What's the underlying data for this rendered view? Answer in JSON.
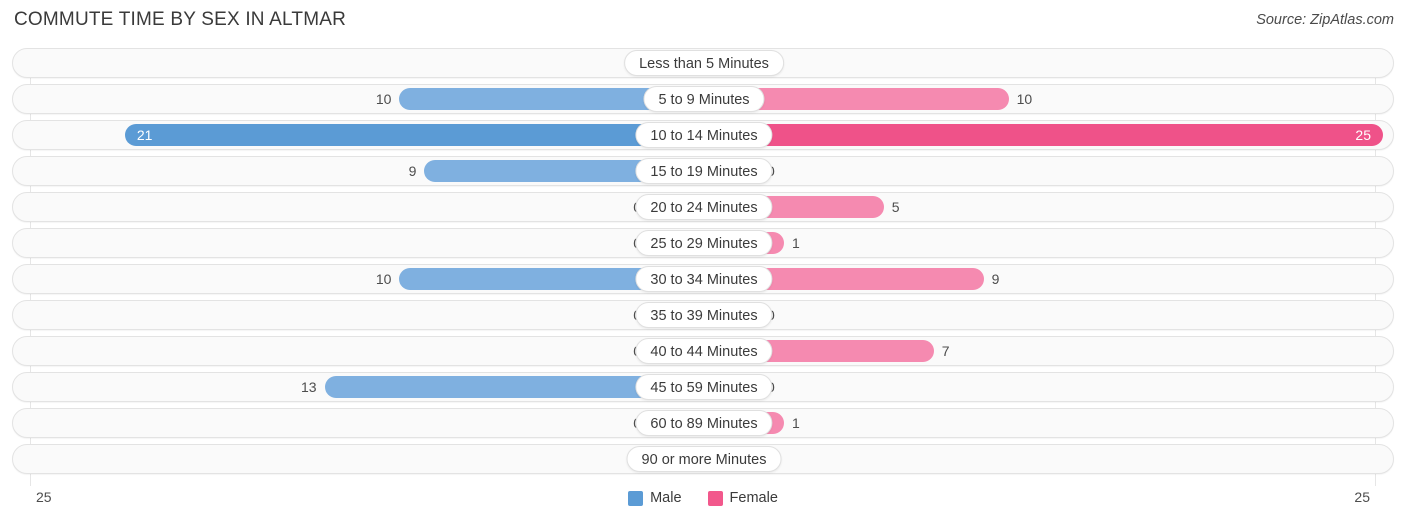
{
  "header": {
    "title": "COMMUTE TIME BY SEX IN ALTMAR",
    "source": "Source: ZipAtlas.com"
  },
  "axis": {
    "min_label": "25",
    "max_label": "25"
  },
  "legend": [
    {
      "label": "Male",
      "color": "#5b9bd5"
    },
    {
      "label": "Female",
      "color": "#f2588c"
    }
  ],
  "colors": {
    "male_normal": "#7fb0e0",
    "male_max": "#5b9bd5",
    "male_zero": "#aecbeb",
    "female_normal": "#f58ab0",
    "female_max": "#ef5289",
    "female_zero": "#f7a7c3",
    "track_bg": "#fafafa",
    "track_border": "#e3e3e3",
    "gridline": "#e6e6e6"
  },
  "chart_data": {
    "type": "bar",
    "orientation": "horizontal-diverging",
    "title": "COMMUTE TIME BY SEX IN ALTMAR",
    "xlabel": "",
    "ylabel": "",
    "xlim": [
      25,
      25
    ],
    "axis_max": 25,
    "grid": true,
    "legend_position": "bottom-center",
    "categories": [
      "Less than 5 Minutes",
      "5 to 9 Minutes",
      "10 to 14 Minutes",
      "15 to 19 Minutes",
      "20 to 24 Minutes",
      "25 to 29 Minutes",
      "30 to 34 Minutes",
      "35 to 39 Minutes",
      "40 to 44 Minutes",
      "45 to 59 Minutes",
      "60 to 89 Minutes",
      "90 or more Minutes"
    ],
    "series": [
      {
        "name": "Male",
        "values": [
          0,
          10,
          21,
          9,
          0,
          0,
          10,
          0,
          0,
          13,
          0,
          0
        ]
      },
      {
        "name": "Female",
        "values": [
          0,
          10,
          25,
          0,
          5,
          1,
          9,
          0,
          7,
          0,
          1,
          0
        ]
      }
    ]
  },
  "rows": [
    {
      "category": "Less than 5 Minutes",
      "male": "0",
      "female": "0",
      "male_value": 0,
      "female_value": 0
    },
    {
      "category": "5 to 9 Minutes",
      "male": "10",
      "female": "10",
      "male_value": 10,
      "female_value": 10
    },
    {
      "category": "10 to 14 Minutes",
      "male": "21",
      "female": "25",
      "male_value": 21,
      "female_value": 25
    },
    {
      "category": "15 to 19 Minutes",
      "male": "9",
      "female": "0",
      "male_value": 9,
      "female_value": 0
    },
    {
      "category": "20 to 24 Minutes",
      "male": "0",
      "female": "5",
      "male_value": 0,
      "female_value": 5
    },
    {
      "category": "25 to 29 Minutes",
      "male": "0",
      "female": "1",
      "male_value": 0,
      "female_value": 1
    },
    {
      "category": "30 to 34 Minutes",
      "male": "10",
      "female": "9",
      "male_value": 10,
      "female_value": 9
    },
    {
      "category": "35 to 39 Minutes",
      "male": "0",
      "female": "0",
      "male_value": 0,
      "female_value": 0
    },
    {
      "category": "40 to 44 Minutes",
      "male": "0",
      "female": "7",
      "male_value": 0,
      "female_value": 7
    },
    {
      "category": "45 to 59 Minutes",
      "male": "13",
      "female": "0",
      "male_value": 13,
      "female_value": 0
    },
    {
      "category": "60 to 89 Minutes",
      "male": "0",
      "female": "1",
      "male_value": 0,
      "female_value": 1
    },
    {
      "category": "90 or more Minutes",
      "male": "0",
      "female": "0",
      "male_value": 0,
      "female_value": 0
    }
  ]
}
